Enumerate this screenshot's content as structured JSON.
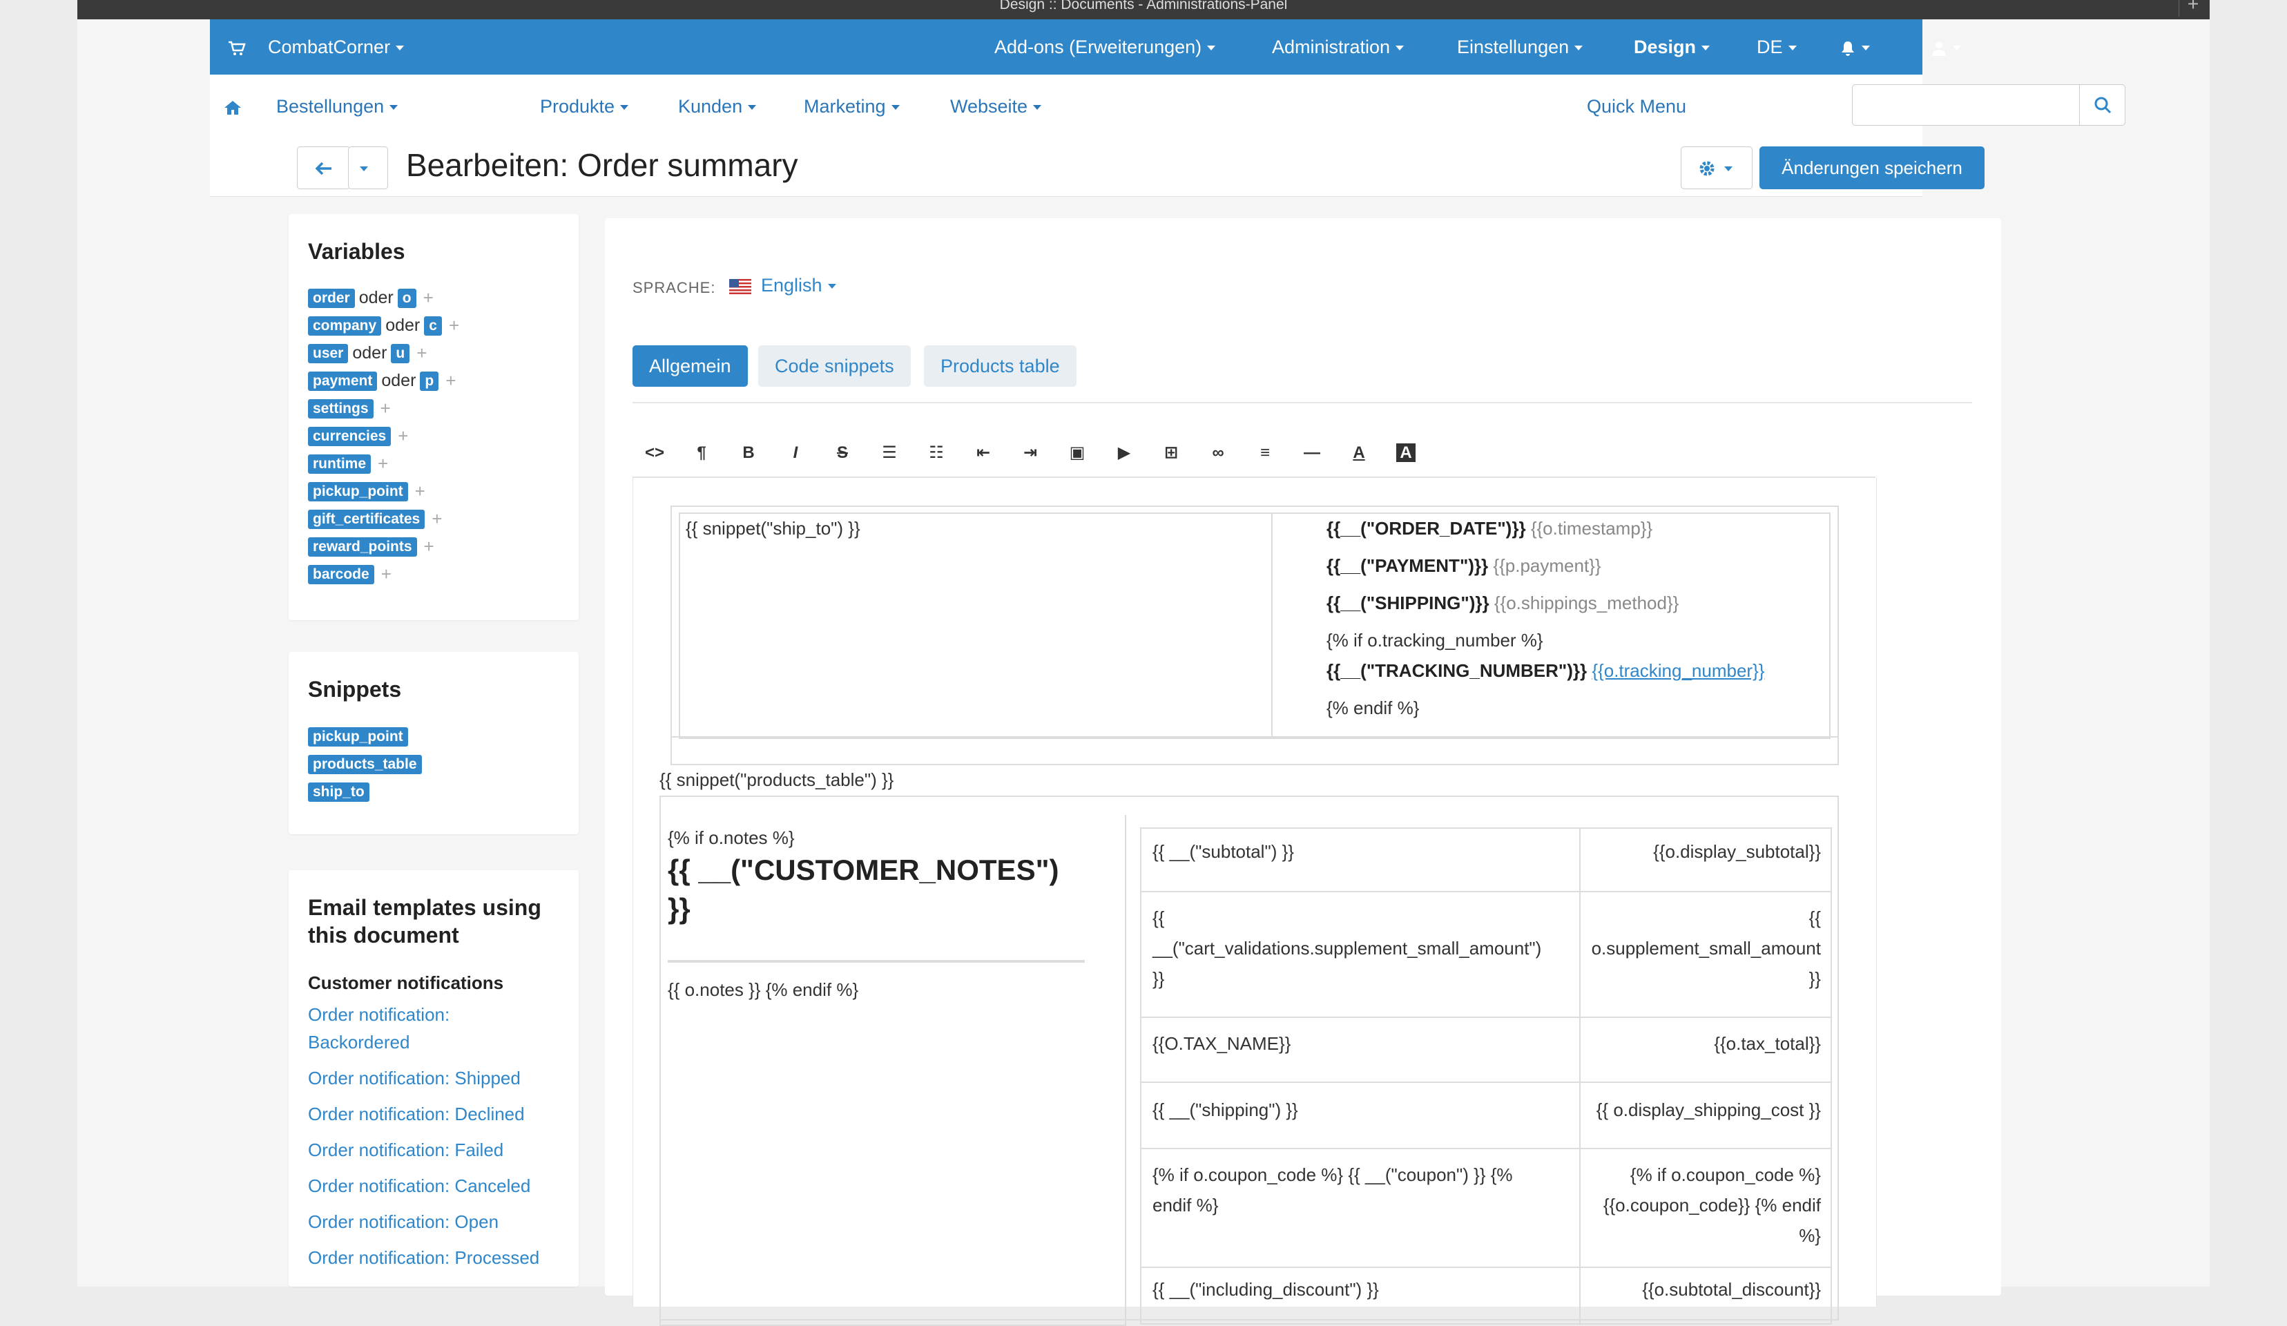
{
  "window": {
    "title": "Design :: Documents - Administrations-Panel"
  },
  "topbar": {
    "store": "CombatCorner",
    "menus": [
      "Add-ons (Erweiterungen)",
      "Administration",
      "Einstellungen",
      "Design",
      "DE"
    ]
  },
  "subnav": {
    "items": [
      "Bestellungen",
      "Produkte",
      "Kunden",
      "Marketing",
      "Webseite"
    ],
    "quick_menu": "Quick Menu",
    "search_placeholder": ""
  },
  "titlebar": {
    "title": "Bearbeiten: Order summary",
    "save": "Änderungen speichern"
  },
  "variables": {
    "heading": "Variables",
    "oder": "oder",
    "rows": [
      {
        "tag": "order",
        "alias": "o"
      },
      {
        "tag": "company",
        "alias": "c"
      },
      {
        "tag": "user",
        "alias": "u"
      },
      {
        "tag": "payment",
        "alias": "p"
      },
      {
        "tag": "settings",
        "alias": ""
      },
      {
        "tag": "currencies",
        "alias": ""
      },
      {
        "tag": "runtime",
        "alias": ""
      },
      {
        "tag": "pickup_point",
        "alias": ""
      },
      {
        "tag": "gift_certificates",
        "alias": ""
      },
      {
        "tag": "reward_points",
        "alias": ""
      },
      {
        "tag": "barcode",
        "alias": ""
      }
    ]
  },
  "snippets": {
    "heading": "Snippets",
    "items": [
      "pickup_point",
      "products_table",
      "ship_to"
    ]
  },
  "email_templates": {
    "heading_line1": "Email templates using",
    "heading_line2": "this document",
    "group": "Customer notifications",
    "links": [
      "Order notification:",
      "Backordered",
      "Order notification: Shipped",
      "Order notification: Declined",
      "Order notification: Failed",
      "Order notification: Canceled",
      "Order notification: Open",
      "Order notification: Processed"
    ]
  },
  "editor": {
    "language_label": "SPRACHE:",
    "language": "English",
    "tabs": [
      "Allgemein",
      "Code snippets",
      "Products table"
    ],
    "toolbar_icons": [
      "code-icon",
      "paragraph-icon",
      "bold-icon",
      "italic-icon",
      "strikethrough-icon",
      "unordered-list-icon",
      "ordered-list-icon",
      "outdent-icon",
      "indent-icon",
      "image-icon",
      "video-icon",
      "table-icon",
      "link-icon",
      "align-icon",
      "horizontal-rule-icon",
      "font-color-icon",
      "background-color-icon"
    ]
  },
  "doc": {
    "ship_to": "{{ snippet(\"ship_to\") }}",
    "order_date_label": "{{__(\"ORDER_DATE\")}}",
    "order_date_val": "{{o.timestamp}}",
    "payment_label": "{{__(\"PAYMENT\")}}",
    "payment_val": "{{p.payment}}",
    "shipping_label": "{{__(\"SHIPPING\")}}",
    "shipping_val": "{{o.shippings_method}}",
    "if_tracking": "{% if o.tracking_number %}",
    "tracking_label": "{{__(\"TRACKING_NUMBER\")}}",
    "tracking_val": "{{o.tracking_number}}",
    "endif": "{% endif %}",
    "products_table": "{{ snippet(\"products_table\") }}",
    "if_notes": "{% if o.notes %}",
    "customer_notes_1": "{{ __(\"CUSTOMER_NOTES\")",
    "customer_notes_2": "}}",
    "notes_val": "{{ o.notes }} {% endif %}",
    "subtotal_label": "{{ __(\"subtotal\") }}",
    "subtotal_val": "{{o.display_subtotal}}",
    "supp_label_1": "{{",
    "supp_label_2": "__(\"cart_validations.supplement_small_amount\")",
    "supp_label_3": "}}",
    "supp_val_1": "{{",
    "supp_val_2": "o.supplement_small_amount",
    "supp_val_3": "}}",
    "tax_label": "{{O.TAX_NAME}}",
    "tax_val": "{{o.tax_total}}",
    "shipping_row_label": "{{ __(\"shipping\") }}",
    "shipping_row_val": "{{ o.display_shipping_cost }}",
    "coupon_label_1": "{% if o.coupon_code %} {{ __(\"coupon\") }} {%",
    "coupon_label_2": "endif %}",
    "coupon_val_1": "{% if o.coupon_code %}",
    "coupon_val_2": "{{o.coupon_code}} {% endif",
    "coupon_val_3": "%}",
    "disc_label": "{{ __(\"including_discount\") }}",
    "disc_val": "{{o.subtotal_discount}}"
  }
}
